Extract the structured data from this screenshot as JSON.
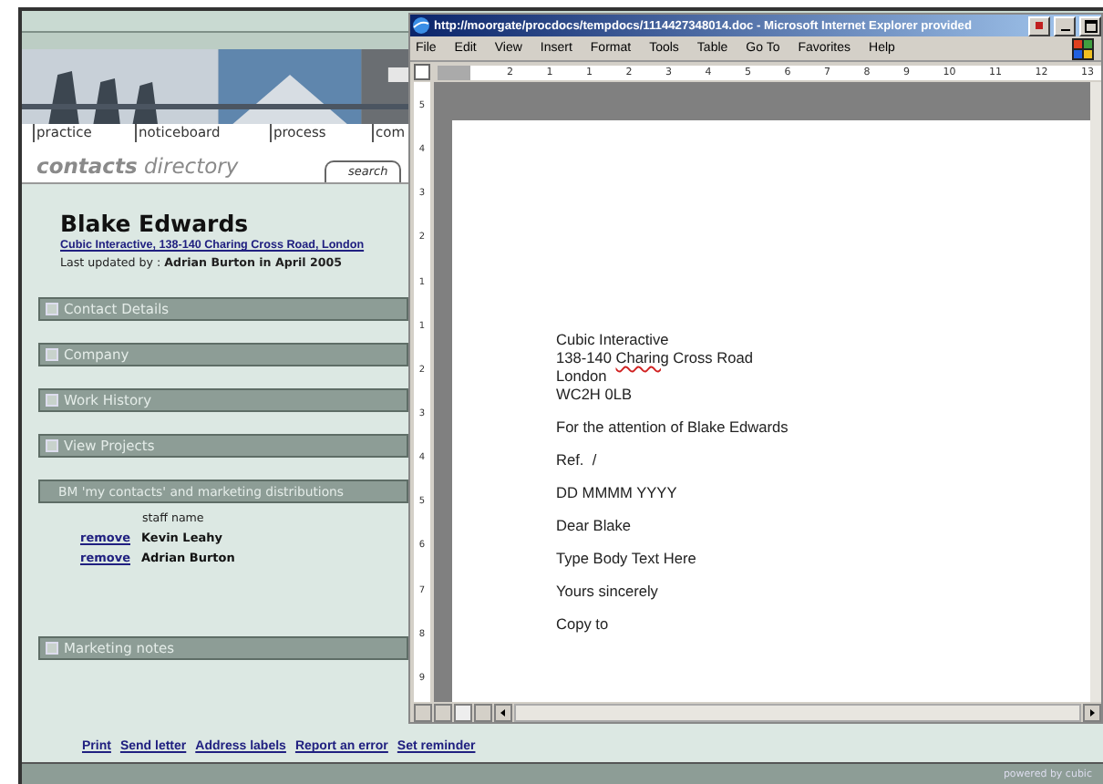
{
  "site": {
    "nav": [
      {
        "label": "practice"
      },
      {
        "label": "noticeboard"
      },
      {
        "label": "process"
      },
      {
        "label": "com"
      }
    ],
    "heading": "**contacts** directory",
    "search_tab": "search",
    "contact": {
      "name": "Blake Edwards",
      "address_link": "Cubic Interactive, 138-140 Charing Cross Road, London",
      "updated": "Last updated by : **Adrian Burton in April 2005**"
    },
    "sections": [
      {
        "title": "Contact Details",
        "expanded": false
      },
      {
        "title": "Company",
        "expanded": false
      },
      {
        "title": "Work History",
        "expanded": false
      },
      {
        "title": "View Projects",
        "expanded": false
      },
      {
        "title": "BM 'my contacts' and marketing distributions",
        "expanded": true,
        "column": "staff name",
        "rows": [
          {
            "action": "remove",
            "name": "Kevin Leahy"
          },
          {
            "action": "remove",
            "name": "Adrian Burton"
          }
        ]
      },
      {
        "title": "Marketing notes",
        "expanded": false
      }
    ],
    "footer_links": [
      "Print",
      "Send letter",
      "Address labels",
      "Report an error",
      "Set reminder"
    ],
    "powered_by": "powered by cubic"
  },
  "window": {
    "title": "http://moorgate/procdocs/tempdocs/1114427348014.doc - Microsoft Internet Explorer provided",
    "menu": [
      "File",
      "Edit",
      "View",
      "Insert",
      "Format",
      "Tools",
      "Table",
      "Go To",
      "Favorites",
      "Help"
    ],
    "ruler": [
      "2",
      "1",
      "1",
      "2",
      "3",
      "4",
      "5",
      "6",
      "7",
      "8",
      "9",
      "10",
      "11",
      "12",
      "13"
    ],
    "vruler": [
      "5",
      "4",
      "3",
      "2",
      "1",
      "1",
      "2",
      "3",
      "4",
      "5",
      "6",
      "7",
      "8",
      "9"
    ],
    "document": [
      {
        "lines": [
          [
            {
              "text": "Cubic Interactive",
              "misspelled": false
            }
          ],
          [
            {
              "text": "138-140 ",
              "misspelled": false
            },
            {
              "text": "Charing",
              "misspelled": true
            },
            {
              "text": " Cross Road",
              "misspelled": false
            }
          ],
          [
            {
              "text": "London",
              "misspelled": false
            }
          ],
          [
            {
              "text": "WC2H 0LB",
              "misspelled": false
            }
          ]
        ]
      },
      {
        "lines": [
          [
            {
              "text": "For the attention of Blake Edwards",
              "misspelled": false
            }
          ]
        ]
      },
      {
        "lines": [
          [
            {
              "text": "Ref.  /",
              "misspelled": false
            }
          ]
        ]
      },
      {
        "lines": [
          [
            {
              "text": "DD MMMM YYYY",
              "misspelled": false
            }
          ]
        ]
      },
      {
        "lines": [
          [
            {
              "text": "Dear Blake",
              "misspelled": false
            }
          ]
        ]
      },
      {
        "lines": [
          [
            {
              "text": "Type Body Text Here",
              "misspelled": false
            }
          ]
        ]
      },
      {
        "lines": [
          [
            {
              "text": "Yours sincerely",
              "misspelled": false
            }
          ]
        ]
      },
      {
        "lines": [
          [
            {
              "text": "Copy to",
              "misspelled": false
            }
          ]
        ]
      }
    ]
  }
}
